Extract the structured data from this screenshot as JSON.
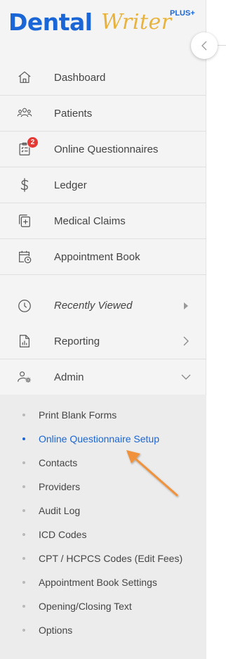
{
  "brand": {
    "name_part1": "Dental",
    "name_part2": "Writer",
    "edition": "PLUS+"
  },
  "colors": {
    "brand_blue": "#1a66d6",
    "brand_gold": "#e9b23a",
    "badge_red": "#e53935",
    "arrow_orange": "#f0923a"
  },
  "menu": {
    "items": [
      {
        "label": "Dashboard",
        "icon": "home-icon"
      },
      {
        "label": "Patients",
        "icon": "users-icon"
      },
      {
        "label": "Online Questionnaires",
        "icon": "clipboard-icon",
        "badge": "2"
      },
      {
        "label": "Ledger",
        "icon": "dollar-icon"
      },
      {
        "label": "Medical Claims",
        "icon": "medical-claim-icon"
      },
      {
        "label": "Appointment Book",
        "icon": "calendar-clock-icon"
      },
      {
        "label": "Recently Viewed",
        "icon": "clock-icon"
      },
      {
        "label": "Reporting",
        "icon": "report-icon"
      },
      {
        "label": "Admin",
        "icon": "admin-icon"
      }
    ]
  },
  "submenu": {
    "items": [
      {
        "label": "Print Blank Forms"
      },
      {
        "label": "Online Questionnaire Setup",
        "active": true
      },
      {
        "label": "Contacts"
      },
      {
        "label": "Providers"
      },
      {
        "label": "Audit Log"
      },
      {
        "label": "ICD Codes"
      },
      {
        "label": "CPT / HCPCS Codes (Edit Fees)"
      },
      {
        "label": "Appointment Book Settings"
      },
      {
        "label": "Opening/Closing Text"
      },
      {
        "label": "Options"
      }
    ]
  }
}
